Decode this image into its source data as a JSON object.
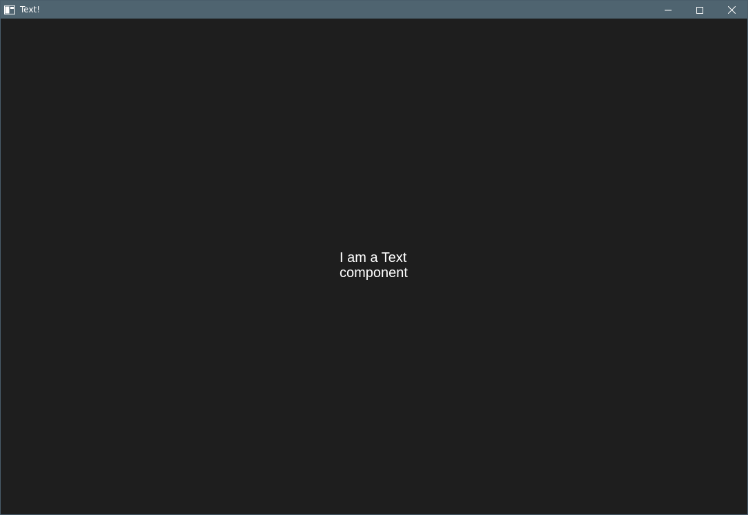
{
  "window": {
    "title": "Text!",
    "icon": "app-window-icon",
    "controls": {
      "minimize_icon": "minimize-icon",
      "maximize_icon": "maximize-icon",
      "close_icon": "close-icon"
    },
    "colors": {
      "titlebar": "#4f6470",
      "background": "#1e1e1e",
      "text": "#ffffff"
    }
  },
  "content": {
    "text": "I am a Text component"
  }
}
